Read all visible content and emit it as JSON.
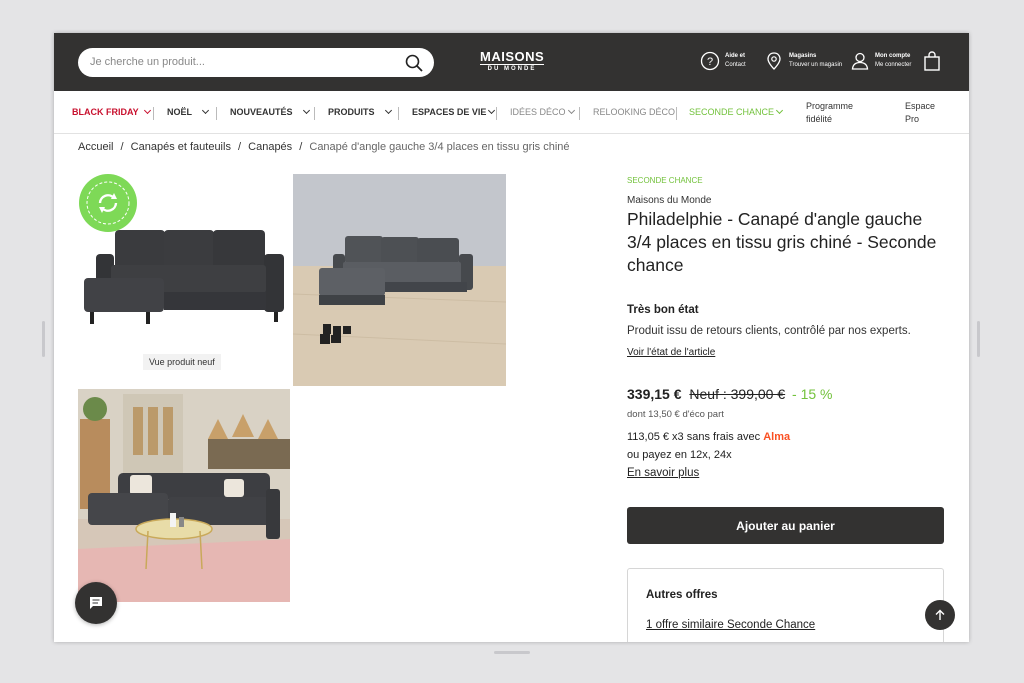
{
  "header": {
    "search_placeholder": "Je cherche un produit...",
    "logo_line1": "MAISONS",
    "logo_line2": "DU MONDE",
    "help_title": "Aide et",
    "help_sub": "Contact",
    "stores_title": "Magasins",
    "stores_sub": "Trouver un magasin",
    "account_title": "Mon compte",
    "account_sub": "Me connecter",
    "colors": {
      "bar": "#333231",
      "accent_green": "#73c23c",
      "accent_red": "#c8102e"
    }
  },
  "nav": {
    "items": [
      {
        "label": "BLACK FRIDAY"
      },
      {
        "label": "NOËL"
      },
      {
        "label": "NOUVEAUTÉS"
      },
      {
        "label": "PRODUITS"
      },
      {
        "label": "ESPACES DE VIE"
      },
      {
        "label": "IDÉES DÉCO"
      },
      {
        "label": "RELOOKING DÉCO"
      },
      {
        "label": "SECONDE CHANCE"
      },
      {
        "label": "Programme fidélité"
      },
      {
        "label": "Espace Pro"
      }
    ]
  },
  "breadcrumb": [
    "Accueil",
    "/",
    "Canapés et fauteuils",
    "/",
    "Canapés",
    "/",
    "Canapé d'angle gauche 3/4 places en tissu gris chiné"
  ],
  "gallery": {
    "badge_text": "SECONDE CHANCE",
    "new_product_tag": "Vue produit neuf"
  },
  "product": {
    "category_label": "SECONDE CHANCE",
    "brand": "Maisons du Monde",
    "title": "Philadelphie - Canapé d'angle gauche 3/4 places en tissu gris chiné - Seconde chance",
    "condition": "Très bon état",
    "condition_desc": "Produit issu de retours clients, contrôlé par nos experts.",
    "condition_link": "Voir l'état de l'article",
    "price": "339,15 €",
    "old_price": "Neuf : 399,00 €",
    "discount": "- 15 %",
    "eco_part": "dont 13,50 € d'éco part",
    "installment": "113,05 € x3 sans frais",
    "installment_with": "avec",
    "installment_brand": "Alma",
    "alt_payment": "ou payez en 12x, 24x",
    "learn_more": "En savoir plus",
    "add_to_cart": "Ajouter au panier"
  },
  "offers": {
    "title": "Autres offres",
    "link": "1 offre similaire Seconde Chance"
  }
}
